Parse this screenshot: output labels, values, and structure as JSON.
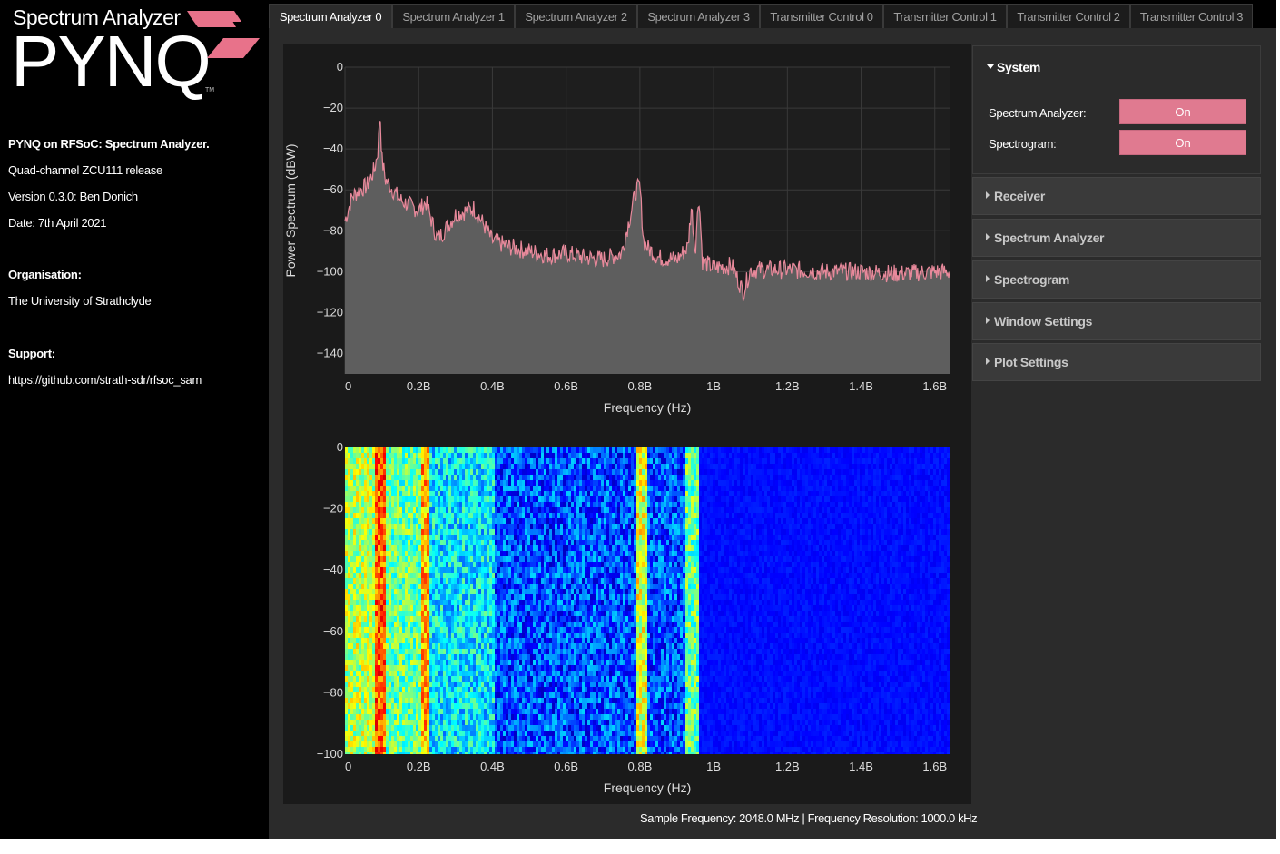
{
  "sidebar": {
    "brand_sub": "Spectrum Analyzer",
    "brand_main": "PYNQ",
    "brand_tm": "TM",
    "title": "PYNQ on RFSoC: Spectrum Analyzer.",
    "release": "Quad-channel ZCU111 release",
    "version": "Version 0.3.0: Ben Donich",
    "date": "Date: 7th April 2021",
    "organisation_label": "Organisation:",
    "organisation": "The University of Strathclyde",
    "support_label": "Support:",
    "support_url": "https://github.com/strath-sdr/rfsoc_sam",
    "colors": {
      "logo_accent": "#e8728a"
    }
  },
  "tabs": [
    {
      "label": "Spectrum Analyzer 0",
      "active": true
    },
    {
      "label": "Spectrum Analyzer 1",
      "active": false
    },
    {
      "label": "Spectrum Analyzer 2",
      "active": false
    },
    {
      "label": "Spectrum Analyzer 3",
      "active": false
    },
    {
      "label": "Transmitter Control 0",
      "active": false
    },
    {
      "label": "Transmitter Control 1",
      "active": false
    },
    {
      "label": "Transmitter Control 2",
      "active": false
    },
    {
      "label": "Transmitter Control 3",
      "active": false
    }
  ],
  "panel": {
    "system": {
      "title": "System",
      "spectrum_analyzer_label": "Spectrum Analyzer:",
      "spectrum_analyzer_value": "On",
      "spectrogram_label": "Spectrogram:",
      "spectrogram_value": "On"
    },
    "sections": [
      "Receiver",
      "Spectrum Analyzer",
      "Spectrogram",
      "Window Settings",
      "Plot Settings"
    ],
    "colors": {
      "toggle_on": "#e07a90"
    }
  },
  "status": "Sample Frequency: 2048.0 MHz | Frequency Resolution: 1000.0 kHz",
  "chart_data": [
    {
      "type": "area",
      "xlabel": "Frequency (Hz)",
      "ylabel": "Power Spectrum (dBW)",
      "xlim": [
        0,
        1640000000.0
      ],
      "ylim": [
        -150,
        0
      ],
      "x_tick_labels": [
        "0",
        "0.2B",
        "0.4B",
        "0.6B",
        "0.8B",
        "1B",
        "1.2B",
        "1.4B",
        "1.6B"
      ],
      "x_ticks": [
        0,
        200000000.0,
        400000000.0,
        600000000.0,
        800000000.0,
        1000000000.0,
        1200000000.0,
        1400000000.0,
        1600000000.0
      ],
      "y_ticks": [
        0,
        -20,
        -40,
        -60,
        -80,
        -100,
        -120,
        -140
      ],
      "grid": true,
      "line_color": "#e8899b",
      "fill_color": "#5e5e5e",
      "series": [
        {
          "x": [
            0,
            20000000.0,
            40000000.0,
            60000000.0,
            80000000.0,
            90000000.0,
            95000000.0,
            100000000.0,
            110000000.0,
            130000000.0,
            150000000.0,
            200000000.0,
            220000000.0,
            250000000.0,
            270000000.0,
            300000000.0,
            350000000.0,
            380000000.0,
            400000000.0,
            450000000.0,
            500000000.0,
            550000000.0,
            600000000.0,
            650000000.0,
            700000000.0,
            750000000.0,
            790000000.0,
            800000000.0,
            810000000.0,
            820000000.0,
            850000000.0,
            900000000.0,
            930000000.0,
            940000000.0,
            950000000.0,
            960000000.0,
            970000000.0,
            1000000000.0,
            1050000000.0,
            1080000000.0,
            1100000000.0,
            1200000000.0,
            1300000000.0,
            1400000000.0,
            1500000000.0,
            1600000000.0,
            1640000000.0
          ],
          "y": [
            -75,
            -63,
            -60,
            -58,
            -50,
            -40,
            -20,
            -45,
            -55,
            -60,
            -65,
            -70,
            -66,
            -84,
            -80,
            -72,
            -69,
            -78,
            -85,
            -88,
            -90,
            -92,
            -91,
            -93,
            -94,
            -91,
            -60,
            -58,
            -85,
            -88,
            -93,
            -94,
            -88,
            -68,
            -90,
            -62,
            -95,
            -98,
            -97,
            -110,
            -99,
            -99,
            -100,
            -100,
            -101,
            -100,
            -100
          ]
        }
      ]
    },
    {
      "type": "heatmap",
      "xlabel": "Frequency (Hz)",
      "xlim": [
        0,
        1640000000.0
      ],
      "ylim": [
        -100,
        0
      ],
      "x_tick_labels": [
        "0",
        "0.2B",
        "0.4B",
        "0.6B",
        "0.8B",
        "1B",
        "1.2B",
        "1.4B",
        "1.6B"
      ],
      "y_ticks": [
        0,
        -20,
        -40,
        -60,
        -80,
        -100
      ],
      "colormap": "jet",
      "bands": [
        {
          "from": 0,
          "to": 80000000.0,
          "level": 0.55
        },
        {
          "from": 80000000.0,
          "to": 110000000.0,
          "level": 0.85
        },
        {
          "from": 110000000.0,
          "to": 200000000.0,
          "level": 0.45
        },
        {
          "from": 200000000.0,
          "to": 225000000.0,
          "level": 0.75
        },
        {
          "from": 225000000.0,
          "to": 400000000.0,
          "level": 0.3
        },
        {
          "from": 400000000.0,
          "to": 790000000.0,
          "level": 0.1
        },
        {
          "from": 790000000.0,
          "to": 820000000.0,
          "level": 0.6
        },
        {
          "from": 820000000.0,
          "to": 920000000.0,
          "level": 0.1
        },
        {
          "from": 920000000.0,
          "to": 960000000.0,
          "level": 0.45
        },
        {
          "from": 960000000.0,
          "to": 1640000000.0,
          "level": 0.02
        }
      ]
    }
  ]
}
